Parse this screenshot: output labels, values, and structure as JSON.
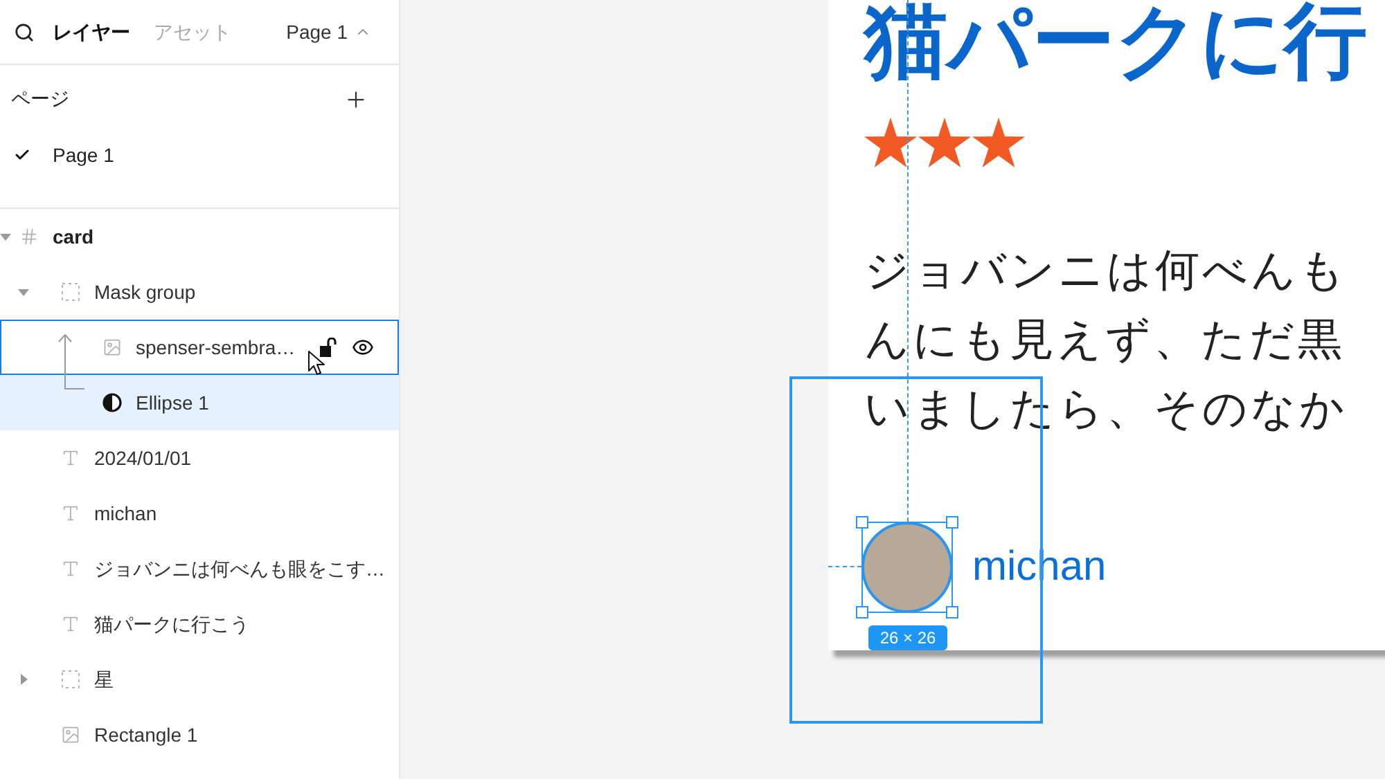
{
  "sidebar": {
    "tabs": [
      {
        "label": "レイヤー",
        "selected": true
      },
      {
        "label": "アセット",
        "selected": false
      }
    ],
    "page_switcher": {
      "label": "Page 1",
      "expanded": true
    },
    "pages_section": {
      "title": "ページ",
      "pages": [
        {
          "label": "Page 1",
          "selected": true
        }
      ]
    },
    "layers": [
      {
        "kind": "frame",
        "name": "card",
        "selected": false,
        "hovered": false,
        "expanded": true,
        "children": [
          {
            "kind": "group",
            "name": "Mask group",
            "selected": false,
            "hovered": false,
            "expanded": true,
            "children": [
              {
                "kind": "image",
                "name": "spenser-sembra…",
                "selected": false,
                "hovered": true,
                "locked": false,
                "visible": true
              },
              {
                "kind": "mask",
                "name": "Ellipse 1",
                "selected": true,
                "hovered": false
              }
            ]
          },
          {
            "kind": "text",
            "name": "2024/01/01",
            "selected": false,
            "hovered": false
          },
          {
            "kind": "text",
            "name": "michan",
            "selected": false,
            "hovered": false
          },
          {
            "kind": "text",
            "name": "ジョバンニは何べんも眼をこす…",
            "selected": false,
            "hovered": false
          },
          {
            "kind": "text",
            "name": "猫パークに行こう",
            "selected": false,
            "hovered": false
          },
          {
            "kind": "group",
            "name": "星",
            "selected": false,
            "hovered": false,
            "expanded": false
          },
          {
            "kind": "image",
            "name": "Rectangle 1",
            "selected": false,
            "hovered": false
          }
        ]
      }
    ]
  },
  "canvas": {
    "card": {
      "title": "猫パークに行",
      "stars": 3,
      "body_lines": [
        "ジョバンニは何べんも",
        "んにも見えず、ただ黒",
        "いましたら、そのなか"
      ],
      "author": "michan"
    },
    "selection": {
      "size_label": "26 × 26"
    }
  }
}
